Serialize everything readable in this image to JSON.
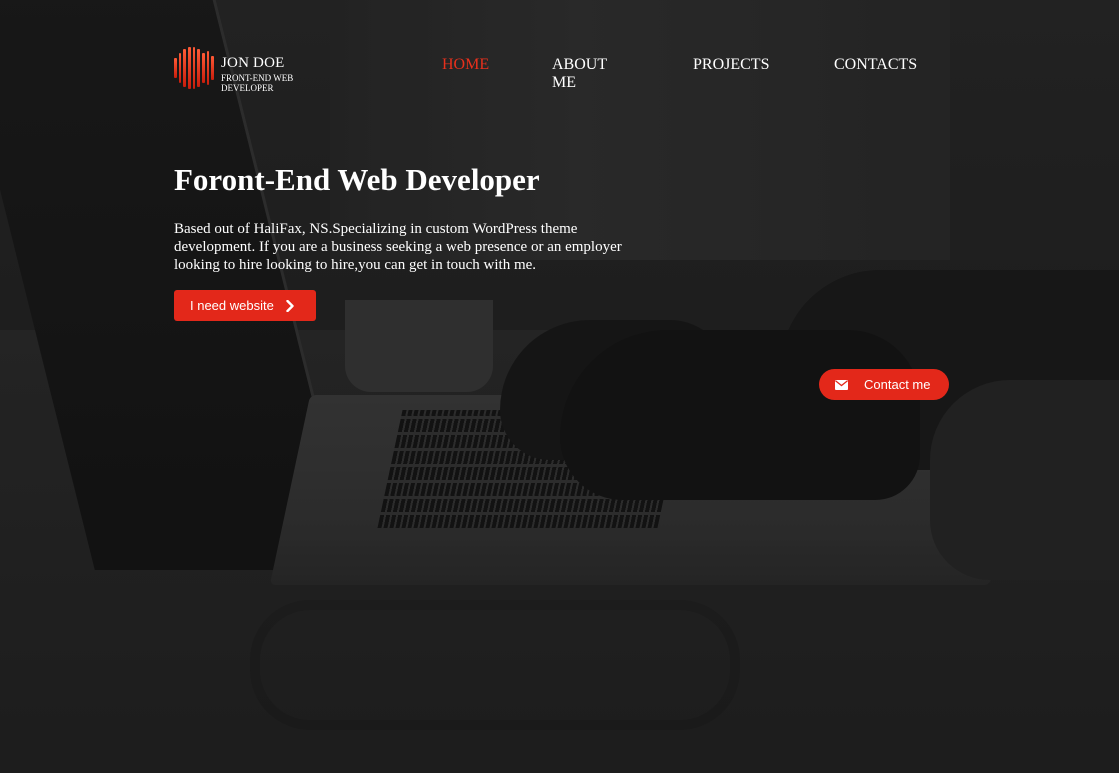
{
  "colors": {
    "accent": "#e3281a",
    "nav_active": "#e8301c",
    "text": "#ffffff"
  },
  "logo": {
    "icon": "logo-bars-icon",
    "name": "JON DOE",
    "subtitle": "FRONT-END WEB DEVELOPER"
  },
  "nav": {
    "items": [
      {
        "label": "HOME",
        "active": true
      },
      {
        "label": "ABOUT ME",
        "active": false
      },
      {
        "label": "PROJECTS",
        "active": false
      },
      {
        "label": "CONTACTS",
        "active": false
      }
    ]
  },
  "hero": {
    "title": "Foront-End Web Developer",
    "description": "Based out of HaliFax, NS.Specializing in custom WordPress theme development. If you are a business seeking a web presence or an employer looking to hire looking to hire,you can get in touch with me.",
    "cta_label": "I need website",
    "cta_icon": "chevron-right-icon"
  },
  "contact_button": {
    "label": "Contact me",
    "icon": "envelope-icon"
  }
}
